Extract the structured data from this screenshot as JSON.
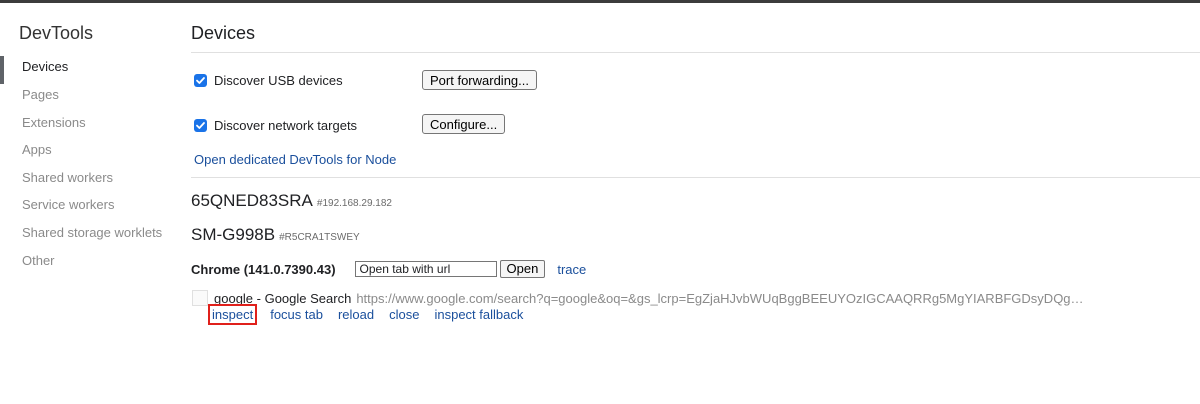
{
  "sidebar": {
    "title": "DevTools",
    "items": [
      {
        "label": "Devices",
        "active": true
      },
      {
        "label": "Pages"
      },
      {
        "label": "Extensions"
      },
      {
        "label": "Apps"
      },
      {
        "label": "Shared workers"
      },
      {
        "label": "Service workers"
      },
      {
        "label": "Shared storage worklets"
      },
      {
        "label": "Other"
      }
    ]
  },
  "main": {
    "title": "Devices",
    "discover_usb": {
      "label": "Discover USB devices",
      "checked": true,
      "button": "Port forwarding..."
    },
    "discover_network": {
      "label": "Discover network targets",
      "checked": true,
      "button": "Configure..."
    },
    "node_link": "Open dedicated DevTools for Node",
    "devices": [
      {
        "name": "65QNED83SRA",
        "serial": "#192.168.29.182"
      },
      {
        "name": "SM-G998B",
        "serial": "#R5CRA1TSWEY"
      }
    ],
    "browser": {
      "name": "Chrome (141.0.7390.43)",
      "url_placeholder": "Open tab with url",
      "open_label": "Open",
      "trace_label": "trace"
    },
    "page": {
      "title": "google - Google Search",
      "url": "https://www.google.com/search?q=google&oq=&gs_lcrp=EgZjaHJvbWUqBggBEEUYOzIGCAAQRRg5MgYIARBFGDsyDQgCE...",
      "actions": [
        "inspect",
        "focus tab",
        "reload",
        "close",
        "inspect fallback"
      ]
    }
  },
  "colors": {
    "link": "#1a4f9c",
    "checkbox": "#1a73e8",
    "highlight": "#e0201b"
  }
}
